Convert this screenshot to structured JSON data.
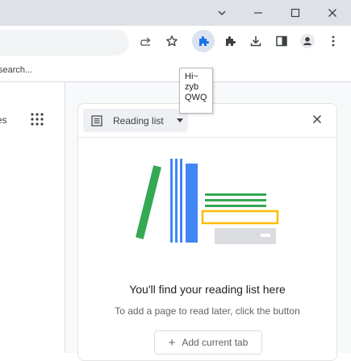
{
  "toolbar": {
    "tooltip_lines": [
      "Hi~",
      "zyb",
      "QWQ"
    ]
  },
  "bookmarks": {
    "partial_label": "search..."
  },
  "left_pane": {
    "partial_label": "es"
  },
  "side_panel": {
    "selector_label": "Reading list",
    "empty_title": "You'll find your reading list here",
    "empty_body": "To add a page to read later, click the button",
    "add_button_label": "Add current tab"
  },
  "icons": {
    "window": [
      "chevron-down-icon",
      "minimize-icon",
      "maximize-icon",
      "close-icon"
    ],
    "toolbar": [
      "share-icon",
      "star-icon",
      "extension-puzzle-icon",
      "extensions-icon",
      "download-icon",
      "side-panel-icon",
      "profile-icon",
      "menu-icon"
    ]
  },
  "colors": {
    "accent_blue": "#1a73e8",
    "illustration_green": "#34a853",
    "illustration_yellow": "#fbbc04",
    "illustration_blue": "#4285f4",
    "active_chip_bg": "#dbe3f0"
  }
}
